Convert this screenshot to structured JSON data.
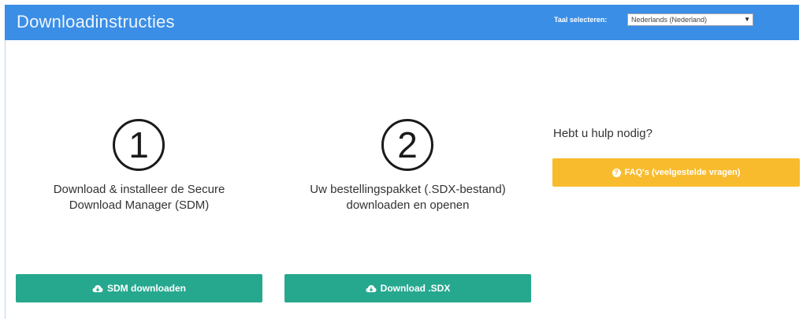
{
  "header": {
    "title": "Downloadinstructies",
    "language_label": "Taal selecteren:",
    "language_value": "Nederlands (Nederland)"
  },
  "steps": [
    {
      "number": "1",
      "text_line1": "Download & installeer de Secure",
      "text_line2": "Download Manager (SDM)",
      "button_label": "SDM downloaden",
      "button_icon": "cloud-download-icon"
    },
    {
      "number": "2",
      "text_line1": "Uw bestellingspakket (.SDX-bestand)",
      "text_line2": "downloaden en openen",
      "button_label": "Download .SDX",
      "button_icon": "cloud-download-icon"
    }
  ],
  "help": {
    "title": "Hebt u hulp nodig?",
    "faq_label": "FAQ's (veelgestelde vragen)",
    "faq_icon": "question-circle-icon"
  },
  "colors": {
    "header_bg": "#3a8ee6",
    "download_button": "#26a88f",
    "faq_button": "#f9bb2e"
  }
}
